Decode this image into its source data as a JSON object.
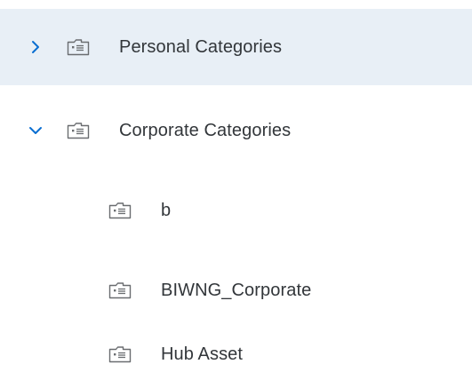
{
  "tree": {
    "items": [
      {
        "label": "Personal Categories",
        "expanded": false,
        "selected": true,
        "level": 0,
        "icon": "category-folder-icon",
        "toggle_icon": "chevron-right-icon"
      },
      {
        "label": "Corporate Categories",
        "expanded": true,
        "selected": false,
        "level": 0,
        "icon": "category-folder-icon",
        "toggle_icon": "chevron-down-icon"
      },
      {
        "label": "b",
        "level": 1,
        "icon": "category-folder-icon"
      },
      {
        "label": "BIWNG_Corporate",
        "level": 1,
        "icon": "category-folder-icon"
      },
      {
        "label": "Hub Asset",
        "level": 1,
        "icon": "category-folder-icon"
      }
    ]
  },
  "colors": {
    "selected_bg": "#e8eff6",
    "chevron": "#0a6ed1",
    "text": "#32363a",
    "icon": "#6a6d70"
  }
}
